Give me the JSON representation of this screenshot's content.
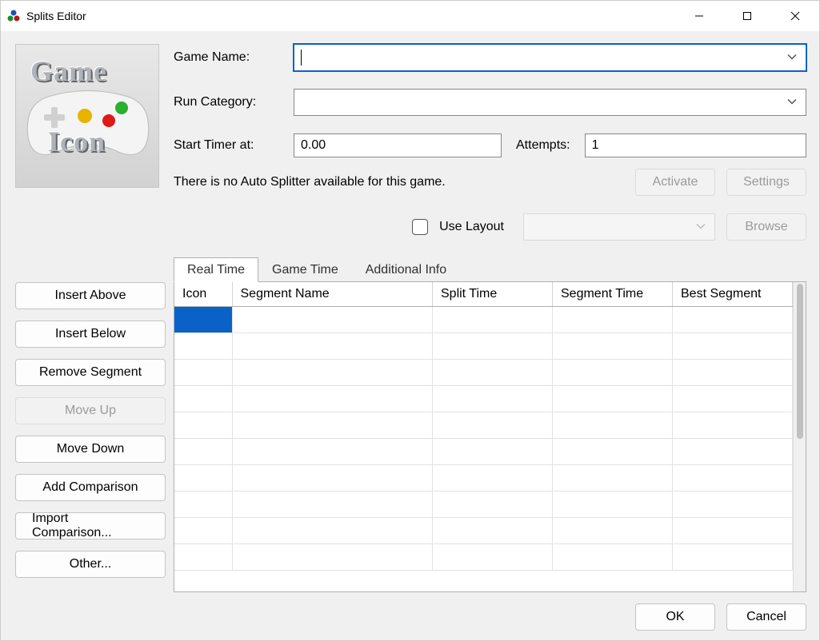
{
  "window": {
    "title": "Splits Editor"
  },
  "icon": {
    "line1": "Game",
    "line2": "Icon"
  },
  "form": {
    "game_name_label": "Game Name:",
    "game_name_value": "",
    "run_category_label": "Run Category:",
    "run_category_value": "",
    "start_timer_label": "Start Timer at:",
    "start_timer_value": "0.00",
    "attempts_label": "Attempts:",
    "attempts_value": "1",
    "autosplitter_msg": "There is no Auto Splitter available for this game.",
    "activate_label": "Activate",
    "settings_label": "Settings",
    "use_layout_label": "Use Layout",
    "browse_label": "Browse"
  },
  "sidebar": {
    "insert_above": "Insert Above",
    "insert_below": "Insert Below",
    "remove_segment": "Remove Segment",
    "move_up": "Move Up",
    "move_down": "Move Down",
    "add_comparison": "Add Comparison",
    "import_comparison": "Import Comparison...",
    "other": "Other..."
  },
  "tabs": {
    "real_time": "Real Time",
    "game_time": "Game Time",
    "additional_info": "Additional Info"
  },
  "grid": {
    "cols": {
      "icon": "Icon",
      "segment_name": "Segment Name",
      "split_time": "Split Time",
      "segment_time": "Segment Time",
      "best_segment": "Best Segment"
    },
    "rows": [
      {
        "selected": true,
        "icon": "",
        "segment_name": "",
        "split_time": "",
        "segment_time": "",
        "best_segment": ""
      },
      {
        "icon": "",
        "segment_name": "",
        "split_time": "",
        "segment_time": "",
        "best_segment": ""
      },
      {
        "icon": "",
        "segment_name": "",
        "split_time": "",
        "segment_time": "",
        "best_segment": ""
      },
      {
        "icon": "",
        "segment_name": "",
        "split_time": "",
        "segment_time": "",
        "best_segment": ""
      },
      {
        "icon": "",
        "segment_name": "",
        "split_time": "",
        "segment_time": "",
        "best_segment": ""
      },
      {
        "icon": "",
        "segment_name": "",
        "split_time": "",
        "segment_time": "",
        "best_segment": ""
      },
      {
        "icon": "",
        "segment_name": "",
        "split_time": "",
        "segment_time": "",
        "best_segment": ""
      },
      {
        "icon": "",
        "segment_name": "",
        "split_time": "",
        "segment_time": "",
        "best_segment": ""
      },
      {
        "icon": "",
        "segment_name": "",
        "split_time": "",
        "segment_time": "",
        "best_segment": ""
      },
      {
        "icon": "",
        "segment_name": "",
        "split_time": "",
        "segment_time": "",
        "best_segment": ""
      }
    ]
  },
  "footer": {
    "ok": "OK",
    "cancel": "Cancel"
  }
}
